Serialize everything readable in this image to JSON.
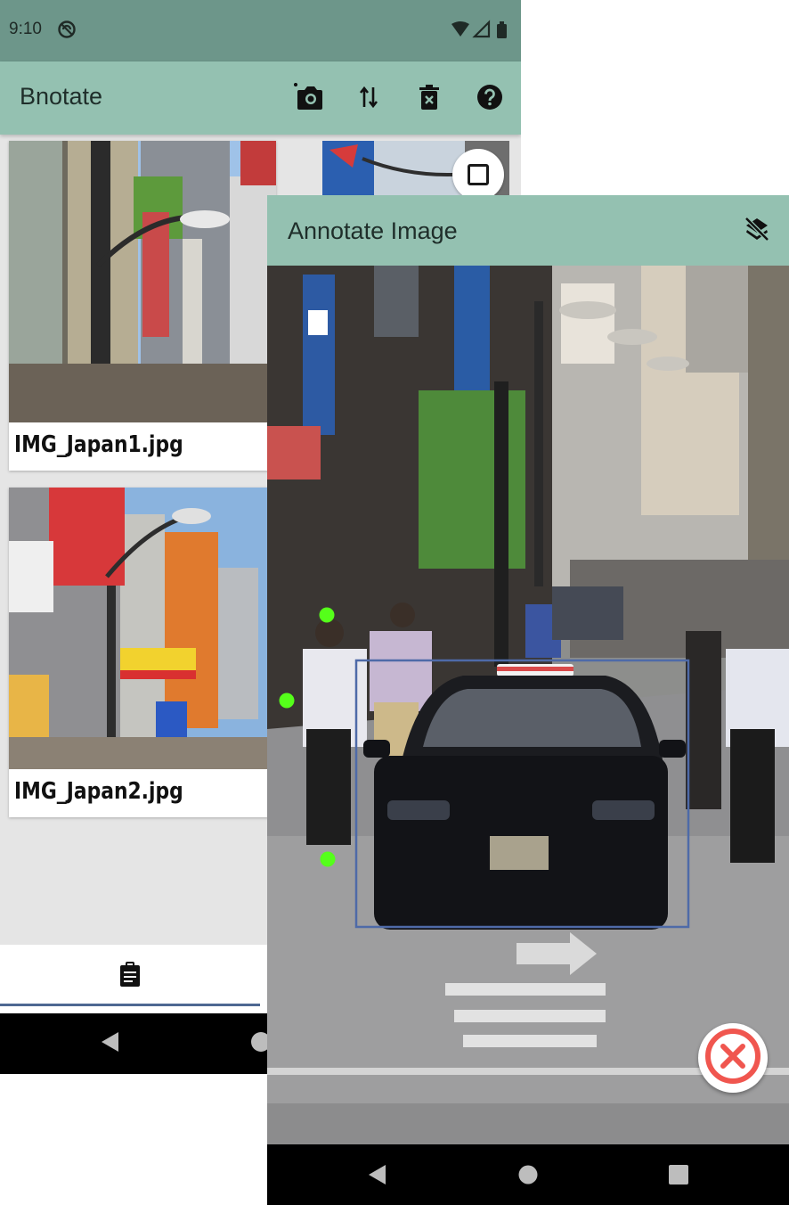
{
  "status_bar": {
    "time": "9:10",
    "icons": [
      "do-not-disturb-icon",
      "wifi-icon",
      "signal-icon",
      "battery-icon"
    ]
  },
  "app_bar": {
    "title": "Bnotate",
    "actions": [
      "add-photo-icon",
      "sort-icon",
      "delete-icon",
      "help-icon"
    ]
  },
  "gallery": {
    "items": [
      {
        "filename": "IMG_Japan1.jpg"
      },
      {
        "filename": "IMG_Japan2.jpg"
      }
    ]
  },
  "bottom_nav": {
    "active_tab_icon": "clipboard-annotate-icon"
  },
  "dialog": {
    "title": "Annotate Image",
    "action_icon": "layers-clear-icon",
    "close_icon": "close-circle-icon"
  },
  "colors": {
    "app_bar": "#94c1b1",
    "status_bar": "#6d968a",
    "box_stroke": "#4e6aa8",
    "point_marker": "#55ff1a",
    "close_accent": "#f0564f",
    "nav_indicator": "#4e6892"
  },
  "system_nav": [
    "back-icon",
    "home-icon",
    "recents-icon"
  ]
}
